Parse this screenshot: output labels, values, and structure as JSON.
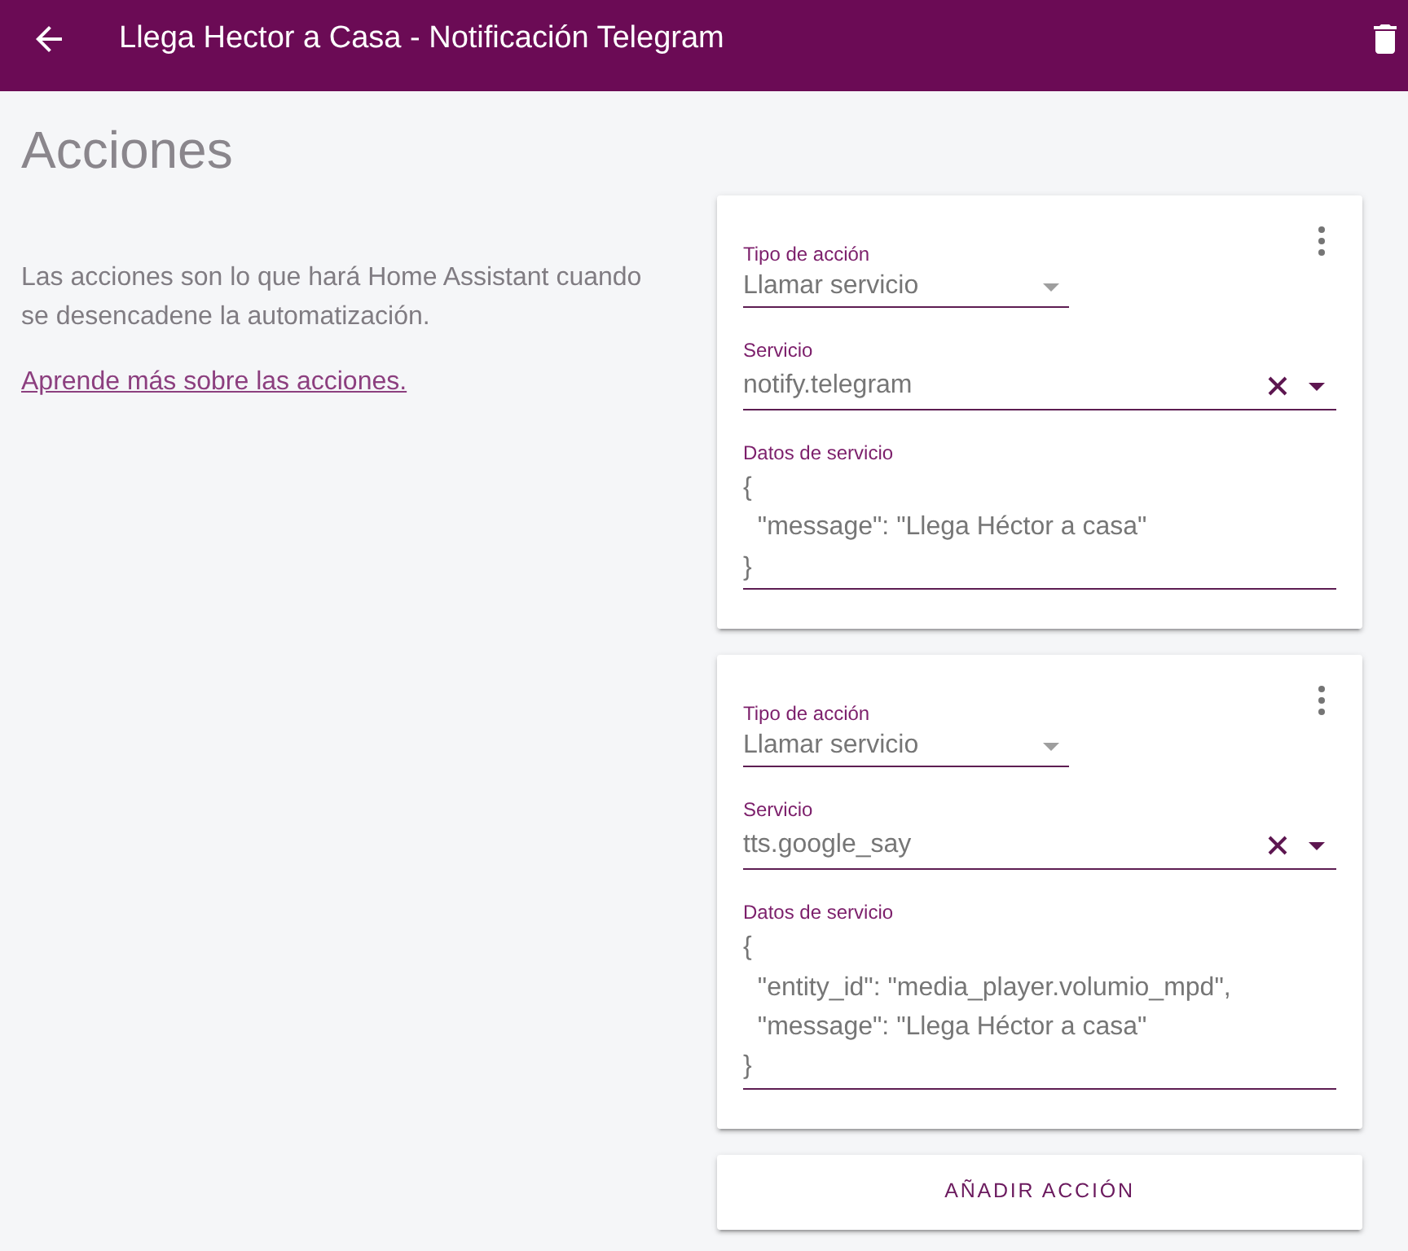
{
  "toolbar": {
    "title": "Llega Hector a Casa - Notificación Telegram"
  },
  "heading": "Acciones",
  "intro": {
    "description": "Las acciones son lo que hará Home Assistant cuando se desencadene la automatización.",
    "link": "Aprende más sobre las acciones."
  },
  "actions": [
    {
      "action_type": {
        "label": "Tipo de acción",
        "value": "Llamar servicio"
      },
      "service": {
        "label": "Servicio",
        "value": "notify.telegram"
      },
      "service_data": {
        "label": "Datos de servicio",
        "value": "{\n  \"message\": \"Llega Héctor a casa\"\n}"
      }
    },
    {
      "action_type": {
        "label": "Tipo de acción",
        "value": "Llamar servicio"
      },
      "service": {
        "label": "Servicio",
        "value": "tts.google_say"
      },
      "service_data": {
        "label": "Datos de servicio",
        "value": "{\n  \"entity_id\": \"media_player.volumio_mpd\",\n  \"message\": \"Llega Héctor a casa\"\n}"
      }
    }
  ],
  "add_button": "AÑADIR ACCIÓN"
}
